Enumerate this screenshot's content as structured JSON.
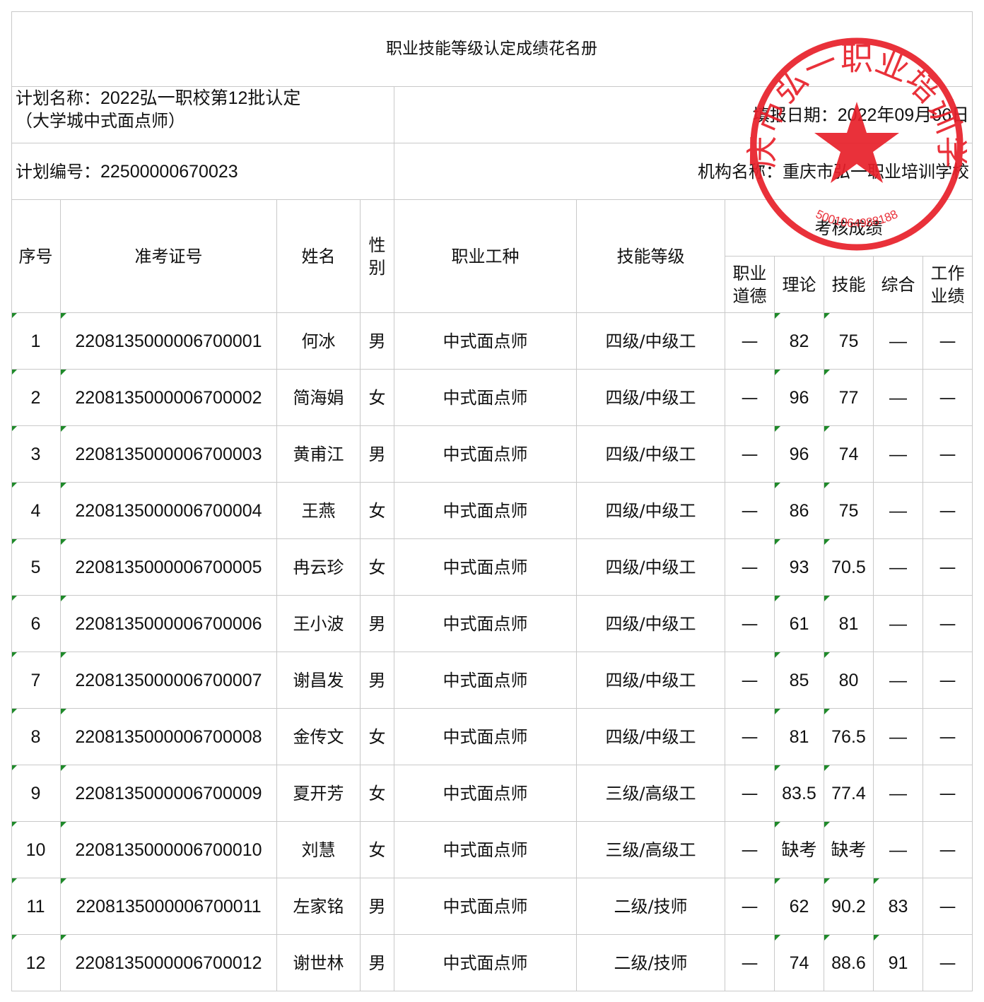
{
  "title": "职业技能等级认定成绩花名册",
  "plan_name_label": "计划名称：",
  "plan_name_line1": "2022弘一职校第12批认定",
  "plan_name_line2": "（大学城中式面点师）",
  "fill_date_label": "填报日期：",
  "fill_date_value": "2022年09月06日",
  "plan_no_label": "计划编号：",
  "plan_no_value": "22500000670023",
  "org_label": "机构名称：",
  "org_value": "重庆市弘一职业培训学校",
  "headers": {
    "seq": "序号",
    "ticket": "准考证号",
    "name": "姓名",
    "gender_1": "性",
    "gender_2": "别",
    "occupation": "职业工种",
    "level": "技能等级",
    "scores_group": "考核成绩",
    "ethics_1": "职业",
    "ethics_2": "道德",
    "theory": "理论",
    "skill": "技能",
    "overall": "综合",
    "work_1": "工作",
    "work_2": "业绩"
  },
  "rows": [
    {
      "seq": "1",
      "ticket": "220813500000670000 1",
      "name": "何冰",
      "gender": "男",
      "occupation": "中式面点师",
      "level": "四级/中级工",
      "ethics": "—",
      "theory": "82",
      "skill": "75",
      "overall": "—",
      "work": "—"
    },
    {
      "seq": "2",
      "ticket": "2208135000006700002",
      "name": "简海娟",
      "gender": "女",
      "occupation": "中式面点师",
      "level": "四级/中级工",
      "ethics": "—",
      "theory": "96",
      "skill": "77",
      "overall": "—",
      "work": "—"
    },
    {
      "seq": "3",
      "ticket": "2208135000006700003",
      "name": "黄甫江",
      "gender": "男",
      "occupation": "中式面点师",
      "level": "四级/中级工",
      "ethics": "—",
      "theory": "96",
      "skill": "74",
      "overall": "—",
      "work": "—"
    },
    {
      "seq": "4",
      "ticket": "2208135000006700004",
      "name": "王燕",
      "gender": "女",
      "occupation": "中式面点师",
      "level": "四级/中级工",
      "ethics": "—",
      "theory": "86",
      "skill": "75",
      "overall": "—",
      "work": "—"
    },
    {
      "seq": "5",
      "ticket": "2208135000006700005",
      "name": "冉云珍",
      "gender": "女",
      "occupation": "中式面点师",
      "level": "四级/中级工",
      "ethics": "—",
      "theory": "93",
      "skill": "70.5",
      "overall": "—",
      "work": "—"
    },
    {
      "seq": "6",
      "ticket": "2208135000006700006",
      "name": "王小波",
      "gender": "男",
      "occupation": "中式面点师",
      "level": "四级/中级工",
      "ethics": "—",
      "theory": "61",
      "skill": "81",
      "overall": "—",
      "work": "—"
    },
    {
      "seq": "7",
      "ticket": "2208135000006700007",
      "name": "谢昌发",
      "gender": "男",
      "occupation": "中式面点师",
      "level": "四级/中级工",
      "ethics": "—",
      "theory": "85",
      "skill": "80",
      "overall": "—",
      "work": "—"
    },
    {
      "seq": "8",
      "ticket": "2208135000006700008",
      "name": "金传文",
      "gender": "女",
      "occupation": "中式面点师",
      "level": "四级/中级工",
      "ethics": "—",
      "theory": "81",
      "skill": "76.5",
      "overall": "—",
      "work": "—"
    },
    {
      "seq": "9",
      "ticket": "2208135000006700009",
      "name": "夏开芳",
      "gender": "女",
      "occupation": "中式面点师",
      "level": "三级/高级工",
      "ethics": "—",
      "theory": "83.5",
      "skill": "77.4",
      "overall": "—",
      "work": "—"
    },
    {
      "seq": "10",
      "ticket": "2208135000006700010",
      "name": "刘慧",
      "gender": "女",
      "occupation": "中式面点师",
      "level": "三级/高级工",
      "ethics": "—",
      "theory": "缺考",
      "skill": "缺考",
      "overall": "—",
      "work": "—"
    },
    {
      "seq": "11",
      "ticket": "2208135000006700011",
      "name": "左家铭",
      "gender": "男",
      "occupation": "中式面点师",
      "level": "二级/技师",
      "ethics": "—",
      "theory": "62",
      "skill": "90.2",
      "overall": "83",
      "work": "—"
    },
    {
      "seq": "12",
      "ticket": "2208135000006700012",
      "name": "谢世林",
      "gender": "男",
      "occupation": "中式面点师",
      "level": "二级/技师",
      "ethics": "—",
      "theory": "74",
      "skill": "88.6",
      "overall": "91",
      "work": "—"
    }
  ],
  "seal": {
    "text": "重庆市弘一职业培训学校",
    "code": "5001064988188",
    "color": "#e8202a"
  }
}
